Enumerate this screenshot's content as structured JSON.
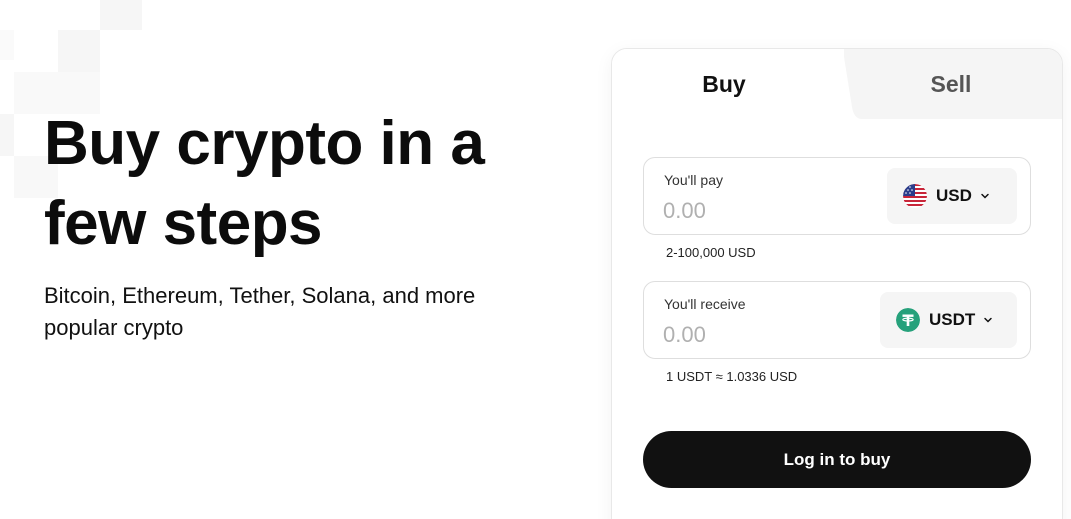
{
  "hero": {
    "title": "Buy crypto in a few steps",
    "subtitle": "Bitcoin, Ethereum, Tether, Solana, and more popular crypto"
  },
  "tabs": [
    {
      "label": "Buy",
      "active": true
    },
    {
      "label": "Sell",
      "active": false
    }
  ],
  "pay": {
    "label": "You'll pay",
    "value": "",
    "placeholder": "0.00",
    "currency": "USD",
    "currency_icon": "us-flag-icon",
    "hint": "2-100,000 USD"
  },
  "receive": {
    "label": "You'll receive",
    "value": "",
    "placeholder": "0.00",
    "currency": "USDT",
    "currency_icon": "tether-icon",
    "hint": "1 USDT ≈ 1.0336 USD"
  },
  "action": {
    "login_label": "Log in to buy"
  },
  "colors": {
    "primary_button": "#111111",
    "tab_inactive_bg": "#f5f5f5",
    "tether_green": "#26a17b",
    "placeholder": "#b0b0b0"
  }
}
